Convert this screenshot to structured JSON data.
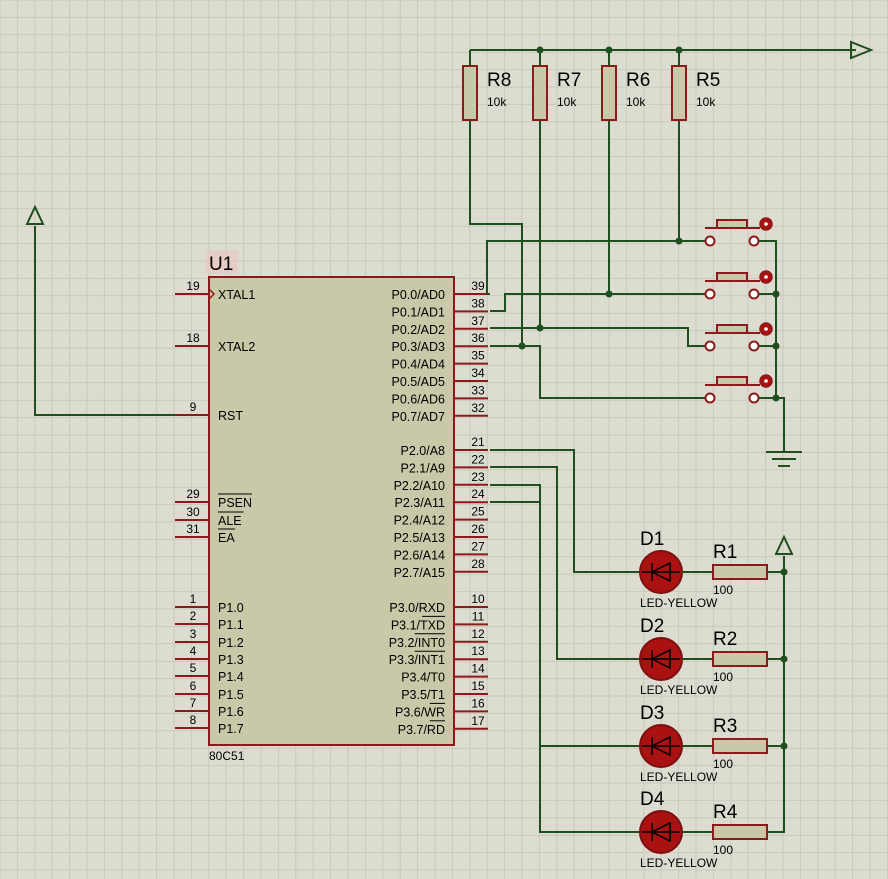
{
  "colors": {
    "background": "#dcdcd0",
    "grid": "#c9c9bb",
    "wire": "#1f4f1f",
    "pin": "#8b1a1a",
    "body": "#c9c8a8",
    "led": "#aa1111"
  },
  "mcu": {
    "ref": "U1",
    "part": "80C51",
    "left_pins": [
      {
        "num": "19",
        "label": "XTAL1"
      },
      {
        "num": "18",
        "label": "XTAL2"
      },
      {
        "num": "9",
        "label": "RST"
      },
      {
        "num": "29",
        "label": "PSEN"
      },
      {
        "num": "30",
        "label": "ALE"
      },
      {
        "num": "31",
        "label": "EA"
      },
      {
        "num": "1",
        "label": "P1.0"
      },
      {
        "num": "2",
        "label": "P1.1"
      },
      {
        "num": "3",
        "label": "P1.2"
      },
      {
        "num": "4",
        "label": "P1.3"
      },
      {
        "num": "5",
        "label": "P1.4"
      },
      {
        "num": "6",
        "label": "P1.5"
      },
      {
        "num": "7",
        "label": "P1.6"
      },
      {
        "num": "8",
        "label": "P1.7"
      }
    ],
    "right_pins": [
      {
        "num": "39",
        "label": "P0.0/AD0"
      },
      {
        "num": "38",
        "label": "P0.1/AD1"
      },
      {
        "num": "37",
        "label": "P0.2/AD2"
      },
      {
        "num": "36",
        "label": "P0.3/AD3"
      },
      {
        "num": "35",
        "label": "P0.4/AD4"
      },
      {
        "num": "34",
        "label": "P0.5/AD5"
      },
      {
        "num": "33",
        "label": "P0.6/AD6"
      },
      {
        "num": "32",
        "label": "P0.7/AD7"
      },
      {
        "num": "21",
        "label": "P2.0/A8"
      },
      {
        "num": "22",
        "label": "P2.1/A9"
      },
      {
        "num": "23",
        "label": "P2.2/A10"
      },
      {
        "num": "24",
        "label": "P2.3/A11"
      },
      {
        "num": "25",
        "label": "P2.4/A12"
      },
      {
        "num": "26",
        "label": "P2.5/A13"
      },
      {
        "num": "27",
        "label": "P2.6/A14"
      },
      {
        "num": "28",
        "label": "P2.7/A15"
      },
      {
        "num": "10",
        "label": "P3.0/RXD"
      },
      {
        "num": "11",
        "label": "P3.1/TXD"
      },
      {
        "num": "12",
        "label": "P3.2/INT0"
      },
      {
        "num": "13",
        "label": "P3.3/INT1"
      },
      {
        "num": "14",
        "label": "P3.4/T0"
      },
      {
        "num": "15",
        "label": "P3.5/T1"
      },
      {
        "num": "16",
        "label": "P3.6/WR"
      },
      {
        "num": "17",
        "label": "P3.7/RD"
      }
    ]
  },
  "pullups": [
    {
      "ref": "R8",
      "value": "10k"
    },
    {
      "ref": "R7",
      "value": "10k"
    },
    {
      "ref": "R6",
      "value": "10k"
    },
    {
      "ref": "R5",
      "value": "10k"
    }
  ],
  "leds": [
    {
      "ref": "D1",
      "type": "LED-YELLOW",
      "res_ref": "R1",
      "res_value": "100"
    },
    {
      "ref": "D2",
      "type": "LED-YELLOW",
      "res_ref": "R2",
      "res_value": "100"
    },
    {
      "ref": "D3",
      "type": "LED-YELLOW",
      "res_ref": "R3",
      "res_value": "100"
    },
    {
      "ref": "D4",
      "type": "LED-YELLOW",
      "res_ref": "R4",
      "res_value": "100"
    }
  ],
  "buttons_count": 4,
  "icons": {
    "power": "power-arrow-icon",
    "ground": "ground-icon",
    "button": "push-button-icon",
    "led": "led-icon"
  }
}
